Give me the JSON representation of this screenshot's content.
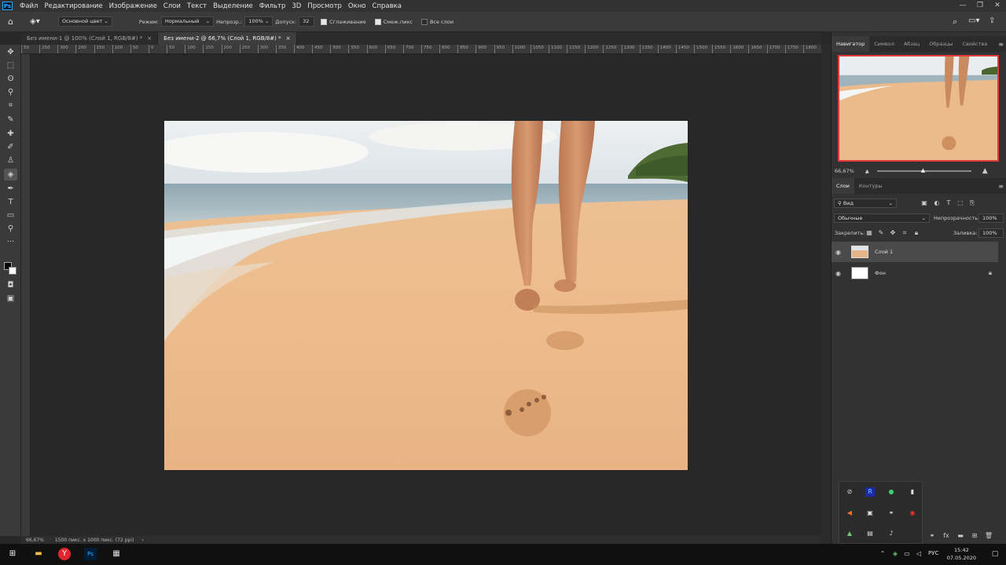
{
  "app": {
    "logo": "Ps",
    "menu": [
      "Файл",
      "Редактирование",
      "Изображение",
      "Слои",
      "Текст",
      "Выделение",
      "Фильтр",
      "3D",
      "Просмотр",
      "Окно",
      "Справка"
    ],
    "window_controls": [
      "—",
      "❐",
      "✕"
    ]
  },
  "options": {
    "fill_source": "Основной цвет",
    "mode_label": "Режим:",
    "mode_value": "Нормальный",
    "opacity_label": "Непрозр.:",
    "opacity_value": "100%",
    "tolerance_label": "Допуск:",
    "tolerance_value": "32",
    "antialias_label": "Сглаживание",
    "antialias_checked": true,
    "contiguous_label": "Смеж.пикс",
    "contiguous_checked": true,
    "all_layers_label": "Все слои",
    "all_layers_checked": false
  },
  "tabs": [
    {
      "label": "Без имени-1 @ 100% (Слой 1, RGB/8#) *",
      "close": "×"
    },
    {
      "label": "Без имени-2 @ 66,7% (Слой 1, RGB/8#) *",
      "close": "×"
    }
  ],
  "ruler": {
    "h_ticks": [
      "50",
      "250",
      "300",
      "200",
      "150",
      "100",
      "50",
      "0",
      "50",
      "100",
      "150",
      "200",
      "250",
      "300",
      "350",
      "400",
      "450",
      "500",
      "550",
      "600",
      "650",
      "700",
      "750",
      "800",
      "850",
      "900",
      "950",
      "1000",
      "1050",
      "1100",
      "1150",
      "1200",
      "1250",
      "1300",
      "1350",
      "1400",
      "1450",
      "1500",
      "1550",
      "1600",
      "1650",
      "1700",
      "1750",
      "1800"
    ]
  },
  "status": {
    "zoom": "66,67%",
    "doc_info": "1500 пикс. x 1000 пикс. (72 ppi)",
    "arrow": "›"
  },
  "navigator": {
    "tabs": [
      "Навигатор",
      "Символ",
      "Абзац",
      "Образцы",
      "Свойства"
    ],
    "zoom": "66,67%"
  },
  "layers": {
    "tabs": [
      "Слои",
      "Контуры"
    ],
    "filter_kind": "Вид",
    "blend_mode": "Обычные",
    "opacity_label": "Непрозрачность:",
    "opacity_value": "100%",
    "lock_label": "Закрепить:",
    "fill_label": "Заливка:",
    "fill_value": "100%",
    "items": [
      {
        "name": "Слой 1",
        "selected": true,
        "locked": false
      },
      {
        "name": "Фон",
        "selected": false,
        "locked": true
      }
    ]
  },
  "taskbar": {
    "lang": "РУС",
    "time": "15:42",
    "date": "07.05.2020"
  },
  "colors": {
    "accent_red": "#e03a3a",
    "ps_blue": "#31a8ff"
  }
}
